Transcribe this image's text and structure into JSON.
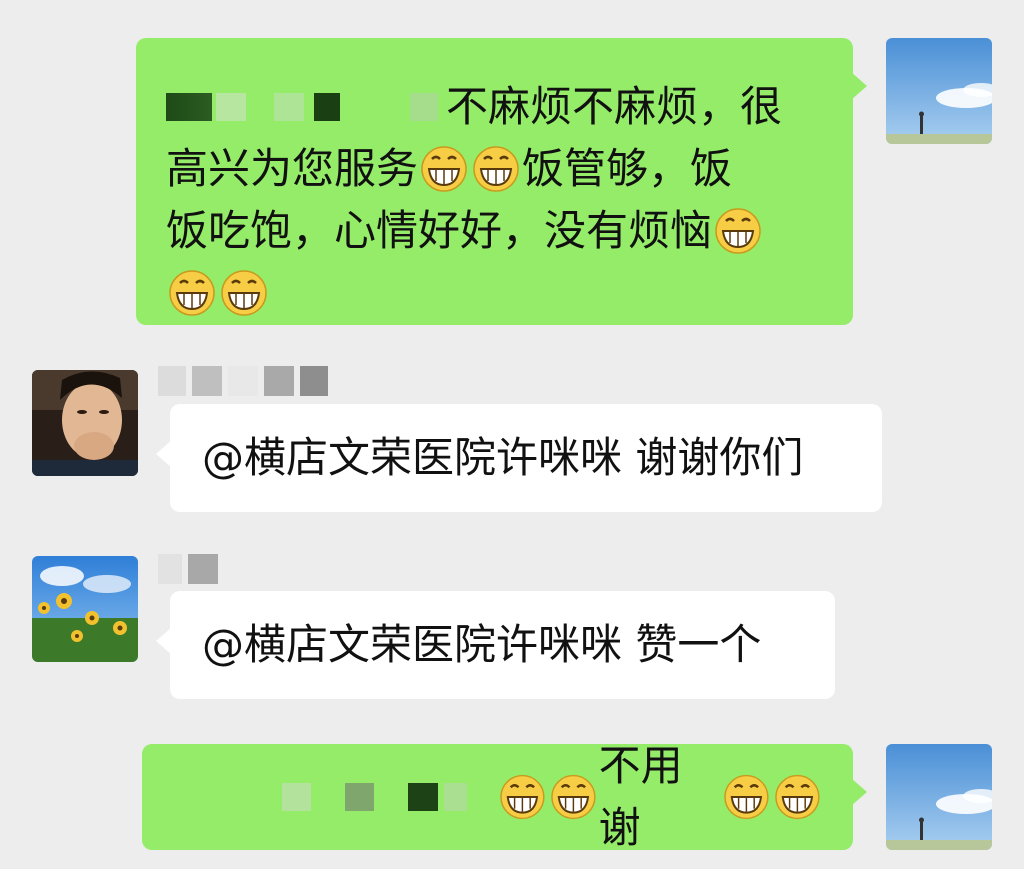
{
  "messages": [
    {
      "side": "sent",
      "lines": [
        "不麻烦不麻烦，很",
        "高兴为您服务",
        "饭管够，饭",
        "饭吃饱，心情好好，没有烦恼"
      ]
    },
    {
      "side": "received",
      "text": "@横店文荣医院许咪咪 谢谢你们"
    },
    {
      "side": "received",
      "text": "@横店文荣医院许咪咪 赞一个"
    },
    {
      "side": "sent",
      "text": "不用谢"
    }
  ],
  "icons": {
    "emoji": "grinning-face-icon",
    "avatar_self": "sky-avatar-icon",
    "avatar_man": "man-photo-avatar-icon",
    "avatar_sunflower": "sunflower-avatar-icon"
  },
  "colors": {
    "background": "#ededed",
    "sent_bubble": "#95ec69",
    "received_bubble": "#ffffff"
  }
}
